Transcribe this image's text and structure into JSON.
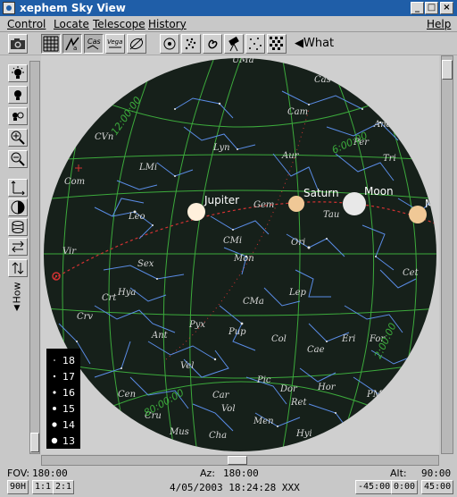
{
  "window": {
    "title": "xephem Sky View"
  },
  "menubar": {
    "items": [
      {
        "label": "Control"
      },
      {
        "label": "Locate"
      },
      {
        "label": "Telescope"
      },
      {
        "label": "History"
      }
    ],
    "help": "Help"
  },
  "toolbar": {
    "what_label": "What",
    "buttons": [
      "camera-icon",
      "grid-icon",
      "altaz-toggle-icon",
      "radec-icon",
      "vegas-icon",
      "horizon-icon",
      "target-icon",
      "cluster-icon",
      "galaxy-icon",
      "telescope-icon",
      "stars-icon",
      "pattern-icon"
    ]
  },
  "sky": {
    "planets": [
      {
        "name": "Jupiter"
      },
      {
        "name": "Saturn"
      },
      {
        "name": "Moon"
      },
      {
        "name": "Mars"
      }
    ],
    "constellations": [
      "UMa",
      "Cam",
      "Cas",
      "CVn",
      "Lyn",
      "Aur",
      "Per",
      "And",
      "Tri",
      "LMi",
      "Com",
      "Leo",
      "Gem",
      "Tau",
      "CMi",
      "Ori",
      "Vir",
      "Sex",
      "Mon",
      "Cet",
      "Crt",
      "Hya",
      "CMa",
      "Lep",
      "Crv",
      "Ant",
      "Pyx",
      "Pup",
      "Col",
      "Cae",
      "Eri",
      "For",
      "Vel",
      "Pic",
      "Dor",
      "Hor",
      "Cen",
      "Car",
      "Vol",
      "Ret",
      "Mus",
      "Men",
      "Cha",
      "Hyi",
      "Cru",
      "PM"
    ],
    "ra_labels": [
      "12:00:00",
      "6:00:00",
      "2:00:00"
    ],
    "dec_labels": [
      "80:00:00"
    ],
    "magnitude_legend": [
      "18",
      "17",
      "16",
      "15",
      "14",
      "13"
    ]
  },
  "status": {
    "fov_label": "FOV:",
    "fov_value": "180:00",
    "az_label": "Az:",
    "az_value": "180:00",
    "alt_label": "Alt:",
    "alt_value": "90:00",
    "datetime": "4/05/2003 18:24:28 XXX",
    "fov_buttons": [
      "90H",
      "1:1",
      "2:1"
    ],
    "alt_buttons": [
      "-45:00",
      "0:00",
      "45:00"
    ]
  },
  "sidebar": {
    "how_label": "How"
  },
  "colors": {
    "sky": "#16201a",
    "grid": "#3caa3c",
    "constellation": "#5a8ce6",
    "ecliptic": "#d23232",
    "titlebar": "#1f5ea8",
    "planet_pale": "#fff0dc",
    "planet_tan": "#f0c896"
  }
}
